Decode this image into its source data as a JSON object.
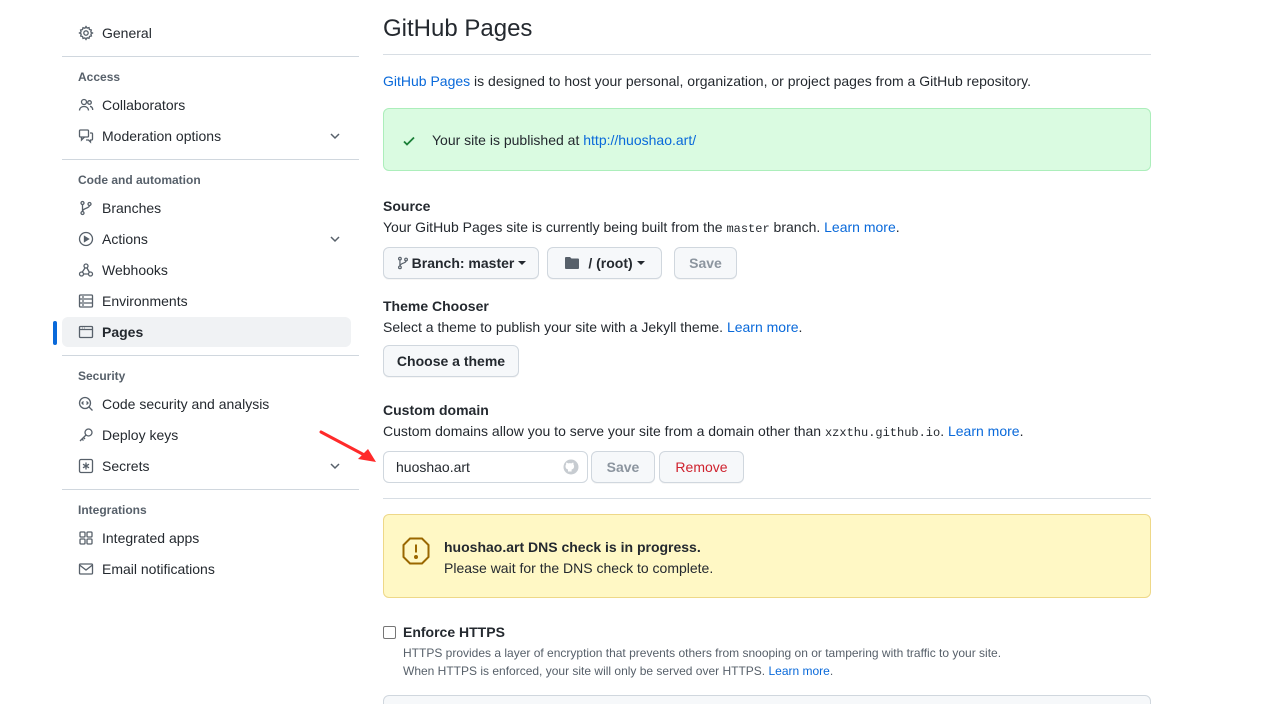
{
  "sidebar": {
    "general": "General",
    "access_heading": "Access",
    "collaborators": "Collaborators",
    "moderation": "Moderation options",
    "code_heading": "Code and automation",
    "branches": "Branches",
    "actions": "Actions",
    "webhooks": "Webhooks",
    "environments": "Environments",
    "pages": "Pages",
    "security_heading": "Security",
    "code_security": "Code security and analysis",
    "deploy_keys": "Deploy keys",
    "secrets": "Secrets",
    "integrations_heading": "Integrations",
    "integrated_apps": "Integrated apps",
    "email_notifications": "Email notifications"
  },
  "main": {
    "title": "GitHub Pages",
    "intro_link": "GitHub Pages",
    "intro_rest": " is designed to host your personal, organization, or project pages from a GitHub repository.",
    "published_prefix": "Your site is published at ",
    "published_url": "http://huoshao.art/",
    "source": {
      "title": "Source",
      "desc_prefix": "Your GitHub Pages site is currently being built from the ",
      "branch_code": "master",
      "desc_suffix": " branch. ",
      "learn_more": "Learn more",
      "period": ".",
      "branch_button": "Branch: master",
      "folder_button": "/ (root)",
      "save": "Save"
    },
    "theme": {
      "title": "Theme Chooser",
      "desc": "Select a theme to publish your site with a Jekyll theme. ",
      "learn_more": "Learn more",
      "period": ".",
      "button": "Choose a theme"
    },
    "custom_domain": {
      "title": "Custom domain",
      "desc_prefix": "Custom domains allow you to serve your site from a domain other than ",
      "default_domain": "xzxthu.github.io",
      "desc_suffix": ". ",
      "learn_more": "Learn more",
      "period": ".",
      "value": "huoshao.art",
      "save": "Save",
      "remove": "Remove"
    },
    "dns": {
      "title": "huoshao.art DNS check is in progress.",
      "subtitle": "Please wait for the DNS check to complete."
    },
    "https": {
      "label": "Enforce HTTPS",
      "checked": false,
      "line1": "HTTPS provides a layer of encryption that prevents others from snooping on or tampering with traffic to your site.",
      "line2_prefix": "When HTTPS is enforced, your site will only be served over HTTPS. ",
      "learn_more": "Learn more",
      "period": "."
    }
  },
  "colors": {
    "accent": "#0969da",
    "success_bg": "#dafbe1",
    "warning_bg": "#fff8c5",
    "danger": "#cf222e",
    "annotation_arrow": "#ff2a2a"
  }
}
